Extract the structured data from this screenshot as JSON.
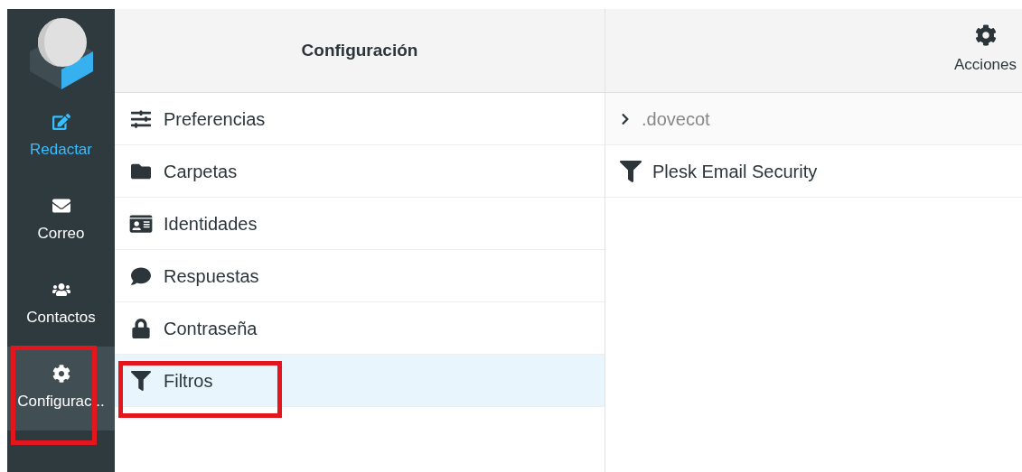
{
  "sidebar": {
    "items": [
      {
        "label": "Redactar",
        "kind": "action",
        "selected": false
      },
      {
        "label": "Correo",
        "kind": "nav",
        "selected": false
      },
      {
        "label": "Contactos",
        "kind": "nav",
        "selected": false
      },
      {
        "label": "Configurac...",
        "kind": "nav",
        "selected": true
      }
    ]
  },
  "settings": {
    "title": "Configuración",
    "items": [
      {
        "label": "Preferencias",
        "selected": false
      },
      {
        "label": "Carpetas",
        "selected": false
      },
      {
        "label": "Identidades",
        "selected": false
      },
      {
        "label": "Respuestas",
        "selected": false
      },
      {
        "label": "Contraseña",
        "selected": false
      },
      {
        "label": "Filtros",
        "selected": true
      }
    ]
  },
  "filters": {
    "actions_label": "Acciones",
    "items": [
      {
        "label": ".dovecot",
        "kind": "set",
        "expanded": false
      },
      {
        "label": "Plesk Email Security",
        "kind": "filter"
      }
    ]
  }
}
